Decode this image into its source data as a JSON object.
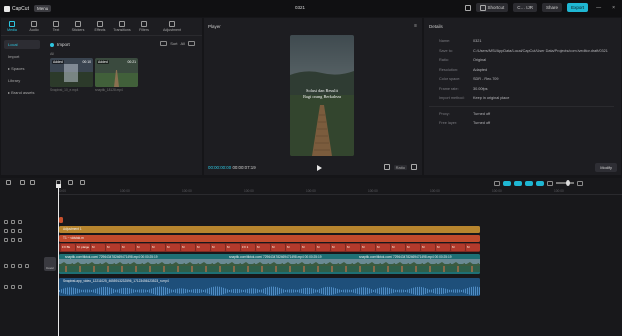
{
  "titlebar": {
    "app_name": "CapCut",
    "menu_label": "Menu",
    "project_title": "0321",
    "shortcut_label": "Shortcut",
    "account_label": "C… IJR",
    "share_label": "Share",
    "export_label": "Export",
    "minimize": "—",
    "close": "×"
  },
  "media_panel": {
    "tabs": [
      {
        "label": "Media",
        "icon": "media-icon"
      },
      {
        "label": "Audio",
        "icon": "audio-icon"
      },
      {
        "label": "Text",
        "icon": "text-icon"
      },
      {
        "label": "Stickers",
        "icon": "sticker-icon"
      },
      {
        "label": "Effects",
        "icon": "effects-icon"
      },
      {
        "label": "Transitions",
        "icon": "transitions-icon"
      },
      {
        "label": "Filters",
        "icon": "filters-icon"
      },
      {
        "label": "Adjustment",
        "icon": "adjustment-icon"
      }
    ],
    "side_nav": [
      "Local",
      "Import",
      "▸ Spaces",
      "Library",
      "▸ Brand assets"
    ],
    "import_label": "Import",
    "tools": {
      "view": "All",
      "sort": "Sort"
    },
    "filter_label": "All",
    "thumbnails": [
      {
        "badge": "Added",
        "duration": "00:10",
        "name": "Snapinst_10_e.mp4"
      },
      {
        "badge": "Added",
        "duration": "00:21",
        "name": "snaptik_18128.mp4"
      }
    ]
  },
  "player": {
    "title": "Player",
    "menu": "≡",
    "overlay_line1": "Solusi dan Resulit",
    "overlay_line2": "Bagi orang Berkaleza",
    "current_time": "00:00:00:00",
    "total_time": "00:00:07:19",
    "ratio_label": "Ratio"
  },
  "details": {
    "title": "Details",
    "rows": [
      {
        "key": "Name:",
        "value": "0321"
      },
      {
        "key": "Save to:",
        "value": "C:/Users/MSI/AppData/Local/CapCut/User Data/Projects/com.lveditor.draft/0321"
      },
      {
        "key": "Ratio:",
        "value": "Original"
      },
      {
        "key": "Resolution:",
        "value": "Adapted"
      },
      {
        "key": "Color space:",
        "value": "SDR - Rec.709"
      },
      {
        "key": "Frame rate:",
        "value": "30.00fps"
      },
      {
        "key": "Import method:",
        "value": "Keep in original place"
      }
    ],
    "rows2": [
      {
        "key": "Proxy:",
        "value": "Turned off"
      },
      {
        "key": "Free layer:",
        "value": "Turned off"
      }
    ],
    "modify_label": "Modify"
  },
  "timeline": {
    "ruler": [
      "00:00",
      "100:00",
      "100:00",
      "100:00",
      "100:00",
      "100:00",
      "100:00",
      "100:00",
      "100:00",
      "100:00"
    ],
    "cover_label": "Cover",
    "adjustment_label": "Adjustment 1",
    "text_clip_label": "T1 ~ vidstak.m",
    "video_clip_label": "snaptik.com/tiktok.com/ 7296434782469471498.mp4   00:00:25:19",
    "video_clip_label2": "snaptik.com/tiktok.com/ 7296434782469471498.mp4   00:00:25:19",
    "video_clip_label3": "snaptik.com/tiktok.com/ 7296434782469471498.mp4   00:00:25:19",
    "audio_clip_label": "Snapinst.app_video_12211025_4655913232596_17123456123523_n.mp4",
    "effects": [
      "FX  Bk",
      "M: plaige",
      "M",
      "M",
      "M",
      "M",
      "M",
      "M",
      "M",
      "M",
      "M",
      "M",
      "FX 1",
      "M",
      "M",
      "M",
      "M",
      "M",
      "M",
      "M",
      "M",
      "M",
      "M",
      "M",
      "M",
      "M",
      "M",
      "M",
      "M",
      "M",
      "M",
      "M",
      "M",
      "M",
      "M",
      "M",
      "M",
      "M",
      "M",
      "M"
    ]
  },
  "colors": {
    "accent": "#1fb7d3",
    "adjustment_clip": "#b7852e",
    "effect_clip": "#b23a2c",
    "text_clip": "#c8502c",
    "video_clip": "#2a8a8a",
    "audio_clip": "#1e4f7a"
  }
}
